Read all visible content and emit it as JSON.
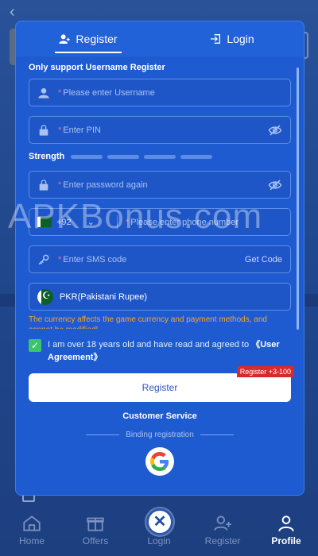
{
  "tabs": [
    {
      "label": "Register",
      "active": true
    },
    {
      "label": "Login",
      "active": false
    }
  ],
  "form": {
    "section_title": "Only support Username Register",
    "username_placeholder": "Please enter Username",
    "pin_placeholder": "Enter PIN",
    "strength_label": "Strength",
    "confirm_placeholder": "Enter password again",
    "phone_code": "+92",
    "phone_placeholder": "Please enter phone number",
    "sms_placeholder": "Enter SMS code",
    "get_code_label": "Get Code",
    "currency": "PKR(Pakistani Rupee)",
    "currency_warning": "The currency affects the game currency and payment methods, and cannot be modified!",
    "agree_text": "I am over 18 years old and have read and agreed to",
    "agree_link": "《User Agreement》",
    "agree_checked": true,
    "register_button": "Register",
    "register_badge": "Register +3-100",
    "customer_service": "Customer Service",
    "binding_label": "Binding registration"
  },
  "watermark": "APKBonus.com",
  "bottom_nav": [
    {
      "label": "Home",
      "icon": "home-icon",
      "active": false
    },
    {
      "label": "Offers",
      "icon": "gift-icon",
      "active": false
    },
    {
      "label": "Login",
      "icon": "close-icon",
      "active": false
    },
    {
      "label": "Register",
      "icon": "add-user-icon",
      "active": false
    },
    {
      "label": "Profile",
      "icon": "user-icon",
      "active": true
    }
  ],
  "colors": {
    "modal_bg": "#2262d8",
    "accent_warning": "#f3a62b",
    "checkbox_green": "#3cc56b",
    "badge_red": "#d82a2a"
  }
}
